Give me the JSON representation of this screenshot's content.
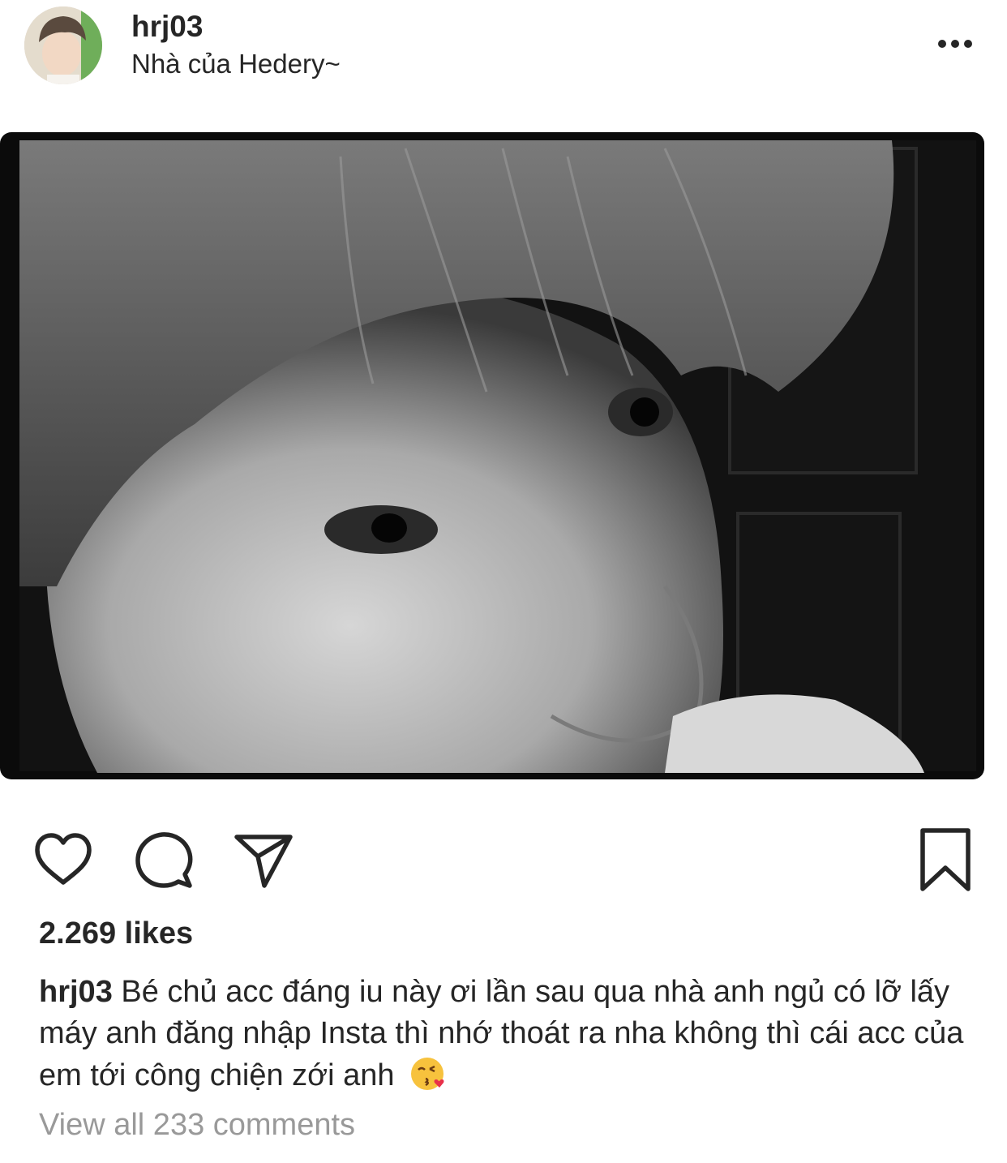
{
  "post": {
    "username": "hrj03",
    "location": "Nhà của Hedery~",
    "likes": "2.269 likes",
    "caption_user": "hrj03",
    "caption_text": "Bé chủ acc đáng iu này ơi lần sau qua nhà anh ngủ có lỡ lấy máy anh đăng nhập Insta thì nhớ thoát ra nha không thì cái acc của em tới công chiện zới anh",
    "caption_emoji": "face-blowing-a-kiss",
    "view_comments": "View all 233 comments",
    "photo_description_colors": {
      "frame": "#0b0b0b",
      "skin": "#c9c9c9",
      "hair": "#6a6a6a"
    }
  },
  "icons": {
    "more": "more-options-icon",
    "like": "heart-icon",
    "comment": "comment-bubble-icon",
    "share": "paper-plane-icon",
    "save": "bookmark-icon"
  },
  "colors": {
    "text": "#262626",
    "muted": "#999999",
    "background": "#ffffff"
  }
}
